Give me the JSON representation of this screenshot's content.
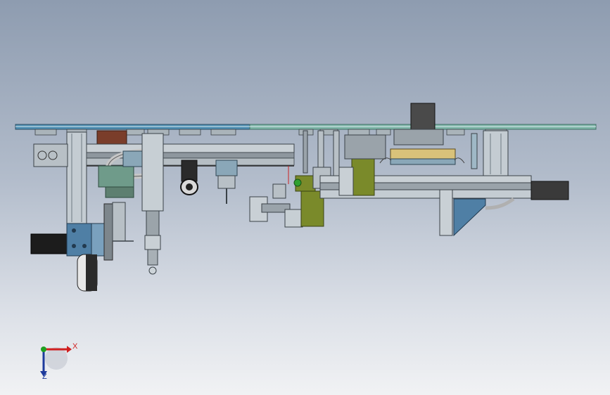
{
  "window": {
    "title": ""
  },
  "view": {
    "background_top": "#8e9cb0",
    "background_bottom": "#f1f2f4",
    "model_colors": {
      "top_plate_left": "#4f8fb3",
      "top_plate_right": "#7fb6a8",
      "motor_body": "#2b4f7a",
      "motor_black": "#1c1c1c",
      "rail_gray": "#9aa3aa",
      "olive_block": "#7a8a2a",
      "bracket_blue": "#4f7fa5",
      "brown_block": "#7a3d2a"
    }
  },
  "triad": {
    "x_label": "X",
    "z_label": "Z",
    "x_color": "#d02020",
    "y_color": "#20a020",
    "z_color": "#1d3a9c"
  }
}
